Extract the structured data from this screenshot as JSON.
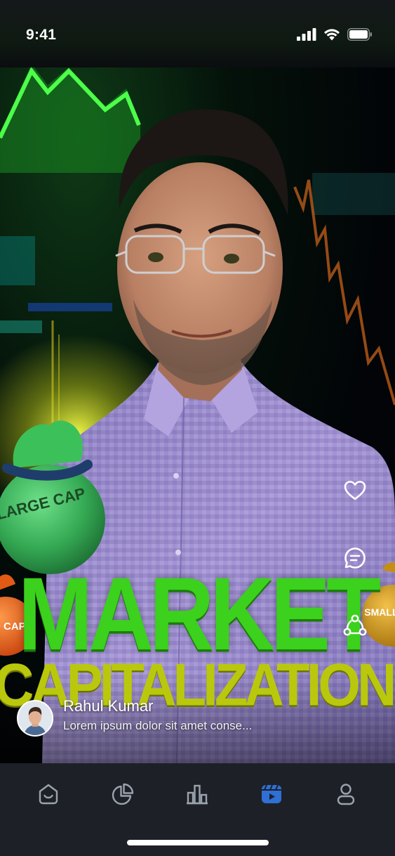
{
  "status_bar": {
    "time": "9:41",
    "icons": [
      "cellular-signal-icon",
      "wifi-icon",
      "battery-icon"
    ]
  },
  "reel": {
    "title_line_1": "MARKET",
    "title_line_2": "CAPITALIZATION",
    "bag_labels": {
      "large": "LARGE CAP",
      "mid": "MID CAP",
      "small": "SMALL CAP"
    },
    "actions": [
      {
        "name": "like",
        "icon": "heart-icon"
      },
      {
        "name": "comment",
        "icon": "comment-icon"
      },
      {
        "name": "share",
        "icon": "share-icon"
      }
    ],
    "author": {
      "name": "Rahul Kumar",
      "caption": "Lorem ipsum dolor sit amet conse..."
    }
  },
  "tab_bar": {
    "tabs": [
      {
        "name": "home",
        "icon": "home-icon",
        "active": false
      },
      {
        "name": "portfolio",
        "icon": "pie-chart-icon",
        "active": false
      },
      {
        "name": "markets",
        "icon": "bar-chart-icon",
        "active": false
      },
      {
        "name": "reels",
        "icon": "video-clapper-icon",
        "active": true
      },
      {
        "name": "profile",
        "icon": "user-icon",
        "active": false
      }
    ]
  },
  "colors": {
    "accent": "#2f6fd6",
    "tab_inactive": "#9aa3ad",
    "tab_bar_bg": "#1d2127",
    "title_green": "#3bd11d",
    "title_yellow": "#b9c80c"
  }
}
